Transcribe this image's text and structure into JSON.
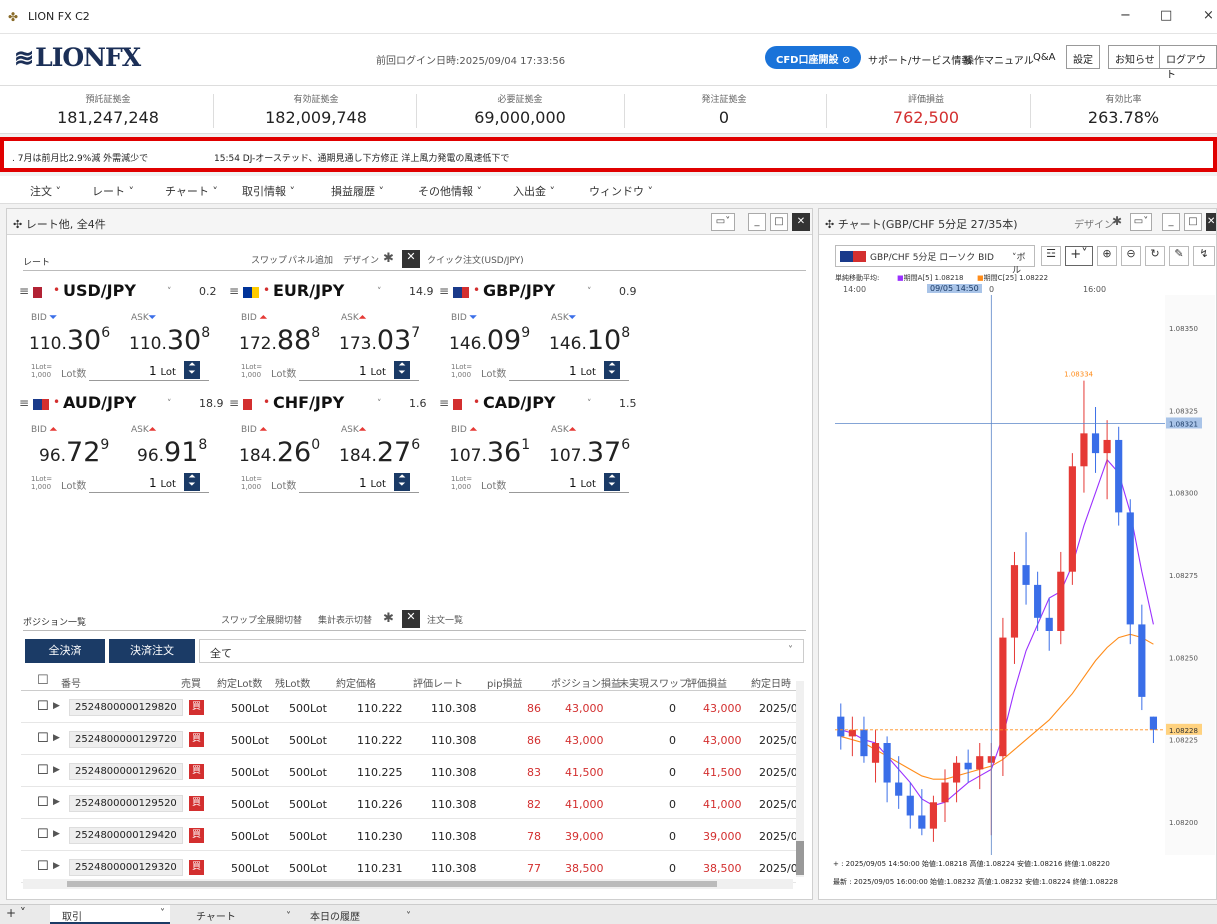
{
  "window": {
    "title": "LION FX C2",
    "min": "−",
    "max": "□",
    "close": "×"
  },
  "header": {
    "logo": "LIONFX",
    "last_login": "前回ログイン日時:2025/09/04 17:33:56",
    "cfd_button": "CFD口座開設",
    "links": [
      "サポート/サービス情報",
      "操作マニュアル",
      "Q&A"
    ],
    "buttons": [
      "設定",
      "お知らせ",
      "ログアウト"
    ]
  },
  "summary": [
    {
      "label": "預託証拠金",
      "value": "181,247,248"
    },
    {
      "label": "有効証拠金",
      "value": "182,009,748"
    },
    {
      "label": "必要証拠金",
      "value": "69,000,000"
    },
    {
      "label": "発注証拠金",
      "value": "0"
    },
    {
      "label": "評価損益",
      "value": "762,500"
    },
    {
      "label": "有効比率",
      "value": "263.78%"
    }
  ],
  "ticker": [
    ". 7月は前月比2.9%減 外需減少で",
    "15:54 DJ-オーステッド、通期見通し下方修正 洋上風力発電の風速低下で"
  ],
  "menu": [
    "注文",
    "レート",
    "チャート",
    "取引情報",
    "損益履歴",
    "その他情報",
    "入出金",
    "ウィンドウ"
  ],
  "rate_panel": {
    "title": "レート他, 全4件",
    "tab_rate": "レート",
    "swap": "スワップ",
    "panel_add": "パネル追加",
    "design": "デザイン",
    "quick_order": "クイック注文(USD/JPY)",
    "bid": "BID",
    "ask": "ASK",
    "lot_unit": "1Lot=",
    "lot_unit2": "1,000",
    "lot_label": "Lot数",
    "lot_value": "1",
    "lot_suffix": "Lot",
    "pairs": [
      {
        "pair": "USD/JPY",
        "spread": "0.2",
        "bid_main": "110.",
        "bid_big": "30",
        "bid_sup": "6",
        "ask_main": "110.",
        "ask_big": "30",
        "ask_sup": "8",
        "bid_dir": "down",
        "ask_dir": "down"
      },
      {
        "pair": "EUR/JPY",
        "spread": "14.9",
        "bid_main": "172.",
        "bid_big": "88",
        "bid_sup": "8",
        "ask_main": "173.",
        "ask_big": "03",
        "ask_sup": "7",
        "bid_dir": "up",
        "ask_dir": "up"
      },
      {
        "pair": "GBP/JPY",
        "spread": "0.9",
        "bid_main": "146.",
        "bid_big": "09",
        "bid_sup": "9",
        "ask_main": "146.",
        "ask_big": "10",
        "ask_sup": "8",
        "bid_dir": "down",
        "ask_dir": "down"
      },
      {
        "pair": "AUD/JPY",
        "spread": "18.9",
        "bid_main": "96.",
        "bid_big": "72",
        "bid_sup": "9",
        "ask_main": "96.",
        "ask_big": "91",
        "ask_sup": "8",
        "bid_dir": "up",
        "ask_dir": "up"
      },
      {
        "pair": "CHF/JPY",
        "spread": "1.6",
        "bid_main": "184.",
        "bid_big": "26",
        "bid_sup": "0",
        "ask_main": "184.",
        "ask_big": "27",
        "ask_sup": "6",
        "bid_dir": "up",
        "ask_dir": "up"
      },
      {
        "pair": "CAD/JPY",
        "spread": "1.5",
        "bid_main": "107.",
        "bid_big": "36",
        "bid_sup": "1",
        "ask_main": "107.",
        "ask_big": "37",
        "ask_sup": "6",
        "bid_dir": "up",
        "ask_dir": "up"
      }
    ]
  },
  "positions": {
    "title": "ポジション一覧",
    "swap": "スワップ",
    "expand_all": "全展開切替",
    "summary_toggle": "集計表示切替",
    "order_list": "注文一覧",
    "close_all": "全決済",
    "close_order": "決済注文",
    "filter": "全て",
    "columns": [
      "番号",
      "売買",
      "約定Lot数",
      "残Lot数",
      "約定価格",
      "評価レート",
      "pip損益",
      "ポジション損益",
      "未実現スワップ",
      "評価損益",
      "約定日時"
    ],
    "rows": [
      {
        "id": "2524800000129820",
        "side": "買",
        "lot": "500Lot",
        "rem": "500Lot",
        "price": "110.222",
        "rate": "110.308",
        "pip": "86",
        "pl": "43,000",
        "swap": "0",
        "eval": "43,000",
        "date": "2025/0"
      },
      {
        "id": "2524800000129720",
        "side": "買",
        "lot": "500Lot",
        "rem": "500Lot",
        "price": "110.222",
        "rate": "110.308",
        "pip": "86",
        "pl": "43,000",
        "swap": "0",
        "eval": "43,000",
        "date": "2025/0"
      },
      {
        "id": "2524800000129620",
        "side": "買",
        "lot": "500Lot",
        "rem": "500Lot",
        "price": "110.225",
        "rate": "110.308",
        "pip": "83",
        "pl": "41,500",
        "swap": "0",
        "eval": "41,500",
        "date": "2025/0"
      },
      {
        "id": "2524800000129520",
        "side": "買",
        "lot": "500Lot",
        "rem": "500Lot",
        "price": "110.226",
        "rate": "110.308",
        "pip": "82",
        "pl": "41,000",
        "swap": "0",
        "eval": "41,000",
        "date": "2025/0"
      },
      {
        "id": "2524800000129420",
        "side": "買",
        "lot": "500Lot",
        "rem": "500Lot",
        "price": "110.230",
        "rate": "110.308",
        "pip": "78",
        "pl": "39,000",
        "swap": "0",
        "eval": "39,000",
        "date": "2025/0"
      },
      {
        "id": "2524800000129320",
        "side": "買",
        "lot": "500Lot",
        "rem": "500Lot",
        "price": "110.231",
        "rate": "110.308",
        "pip": "77",
        "pl": "38,500",
        "swap": "0",
        "eval": "38,500",
        "date": "2025/0"
      }
    ]
  },
  "chart": {
    "title": "チャート(GBP/CHF 5分足 27/35本)",
    "design": "デザイン",
    "toolbar_symbol": "GBP/CHF 5分足 ローソク BID",
    "toolbar_extra": "ボル",
    "ma_label": "単純移動平均:",
    "ma1": "期間A[5] 1.08218",
    "ma2": "期間C[25] 1.08222",
    "time1": "14:00",
    "time_cursor": "09/05 14:50",
    "time_cursor_suffix": "0",
    "time2": "16:00",
    "y_labels": [
      "1.08350",
      "1.08325",
      "1.08300",
      "1.08275",
      "1.08250",
      "1.08225",
      "1.08200"
    ],
    "cursor_price": "1.08321",
    "last_price": "1.08228",
    "high_label": "1.08334",
    "info1": "+ : 2025/09/05 14:50:00 始値:1.08218 高値:1.08224 安値:1.08216 終値:1.08220",
    "info2": "最新 : 2025/09/05 16:00:00 始値:1.08232 高値:1.08232 安値:1.08224 終値:1.08228"
  },
  "bottom_tabs": [
    "取引",
    "チャート",
    "本日の履歴"
  ],
  "colors": {
    "accent": "#1b3b66",
    "red": "#d32f2f",
    "up": "#e53935",
    "down": "#3a6ee8"
  },
  "chart_data": {
    "type": "candlestick",
    "ylim": [
      1.0819,
      1.0836
    ],
    "candles": [
      [
        1.08232,
        1.08236,
        1.08222,
        1.08226
      ],
      [
        1.08226,
        1.08232,
        1.0822,
        1.08228
      ],
      [
        1.08228,
        1.08232,
        1.08218,
        1.0822
      ],
      [
        1.08218,
        1.08228,
        1.08212,
        1.08224
      ],
      [
        1.08224,
        1.08226,
        1.08206,
        1.08212
      ],
      [
        1.08212,
        1.0822,
        1.08204,
        1.08208
      ],
      [
        1.08208,
        1.08212,
        1.08198,
        1.08202
      ],
      [
        1.08202,
        1.0821,
        1.08196,
        1.08198
      ],
      [
        1.08198,
        1.08208,
        1.08194,
        1.08206
      ],
      [
        1.08206,
        1.08216,
        1.082,
        1.08212
      ],
      [
        1.08212,
        1.0822,
        1.08206,
        1.08218
      ],
      [
        1.08218,
        1.08222,
        1.08212,
        1.08216
      ],
      [
        1.08216,
        1.08224,
        1.0821,
        1.0822
      ],
      [
        1.08218,
        1.08224,
        1.08196,
        1.0822
      ],
      [
        1.0822,
        1.08262,
        1.08214,
        1.08256
      ],
      [
        1.08256,
        1.08282,
        1.08248,
        1.08278
      ],
      [
        1.08278,
        1.08288,
        1.08266,
        1.08272
      ],
      [
        1.08272,
        1.08276,
        1.08258,
        1.08262
      ],
      [
        1.08262,
        1.08268,
        1.08252,
        1.08258
      ],
      [
        1.08258,
        1.08282,
        1.08254,
        1.08276
      ],
      [
        1.08276,
        1.08312,
        1.08272,
        1.08308
      ],
      [
        1.08308,
        1.08334,
        1.083,
        1.08318
      ],
      [
        1.08318,
        1.08326,
        1.08306,
        1.08312
      ],
      [
        1.08312,
        1.08322,
        1.08298,
        1.08316
      ],
      [
        1.08316,
        1.0832,
        1.0829,
        1.08294
      ],
      [
        1.08294,
        1.08298,
        1.08254,
        1.0826
      ],
      [
        1.0826,
        1.08266,
        1.08234,
        1.08238
      ],
      [
        1.08232,
        1.08232,
        1.08224,
        1.08228
      ]
    ],
    "ma5": [
      1.08228,
      1.08227,
      1.08225,
      1.08224,
      1.0822,
      1.08216,
      1.08212,
      1.08207,
      1.08205,
      1.08206,
      1.08209,
      1.08212,
      1.08214,
      1.08216,
      1.08226,
      1.0824,
      1.08252,
      1.0826,
      1.08268,
      1.0827,
      1.08278,
      1.0829,
      1.083,
      1.0831,
      1.08306,
      1.08294,
      1.08276,
      1.0826
    ],
    "ma25": [
      1.08226,
      1.08225,
      1.08224,
      1.08222,
      1.0822,
      1.08218,
      1.08216,
      1.08214,
      1.08213,
      1.08213,
      1.08214,
      1.08215,
      1.08216,
      1.08217,
      1.08219,
      1.08222,
      1.08225,
      1.08228,
      1.08231,
      1.08235,
      1.08239,
      1.08244,
      1.08249,
      1.08253,
      1.08256,
      1.08257,
      1.08256,
      1.08254
    ]
  }
}
